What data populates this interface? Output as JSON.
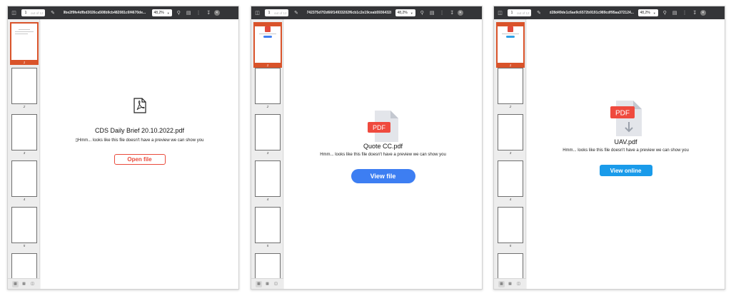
{
  "viewers": [
    {
      "toolbar": {
        "page_current": "1",
        "page_of": "out of 12",
        "file_name": "9be2f9fe4dfbd3026ca508b9cb482081c6f4670de...",
        "zoom": "48,2%"
      },
      "thumb_labels": [
        "1",
        "2",
        "3",
        "4",
        "5"
      ],
      "preview": {
        "file_name": "CDS Daily Brief 20.10.2022.pdf",
        "message": "▯Hmm... looks like this file doesn't have a preview we can show you",
        "button_label": "Open file",
        "accent": "#ea4b3c"
      }
    },
    {
      "toolbar": {
        "page_current": "1",
        "page_of": "out of 12",
        "file_name": "742375d7f2d66f14933202f6cb1c2e19ceab59364328...",
        "zoom": "48,2%"
      },
      "thumb_labels": [
        "1",
        "2",
        "3",
        "4",
        "5"
      ],
      "preview": {
        "icon_text": "PDF",
        "file_name": "Quote CC.pdf",
        "message": "Hmm... looks like this file doesn't have a preview we can show you",
        "button_label": "View file",
        "accent": "#3d7ef2"
      }
    },
    {
      "toolbar": {
        "page_current": "1",
        "page_of": "out of 12",
        "file_name": "d28d49de1c6ae9c6572b9191c989cdf95aa372124...",
        "zoom": "48,2%"
      },
      "thumb_labels": [
        "1",
        "2",
        "3",
        "4",
        "5"
      ],
      "preview": {
        "icon_text": "PDF",
        "file_name": "UAV.pdf",
        "message": "Hmm... looks like this file doesn't have a preview we can show you",
        "button_label": "View online",
        "accent": "#1a9bea"
      }
    }
  ]
}
